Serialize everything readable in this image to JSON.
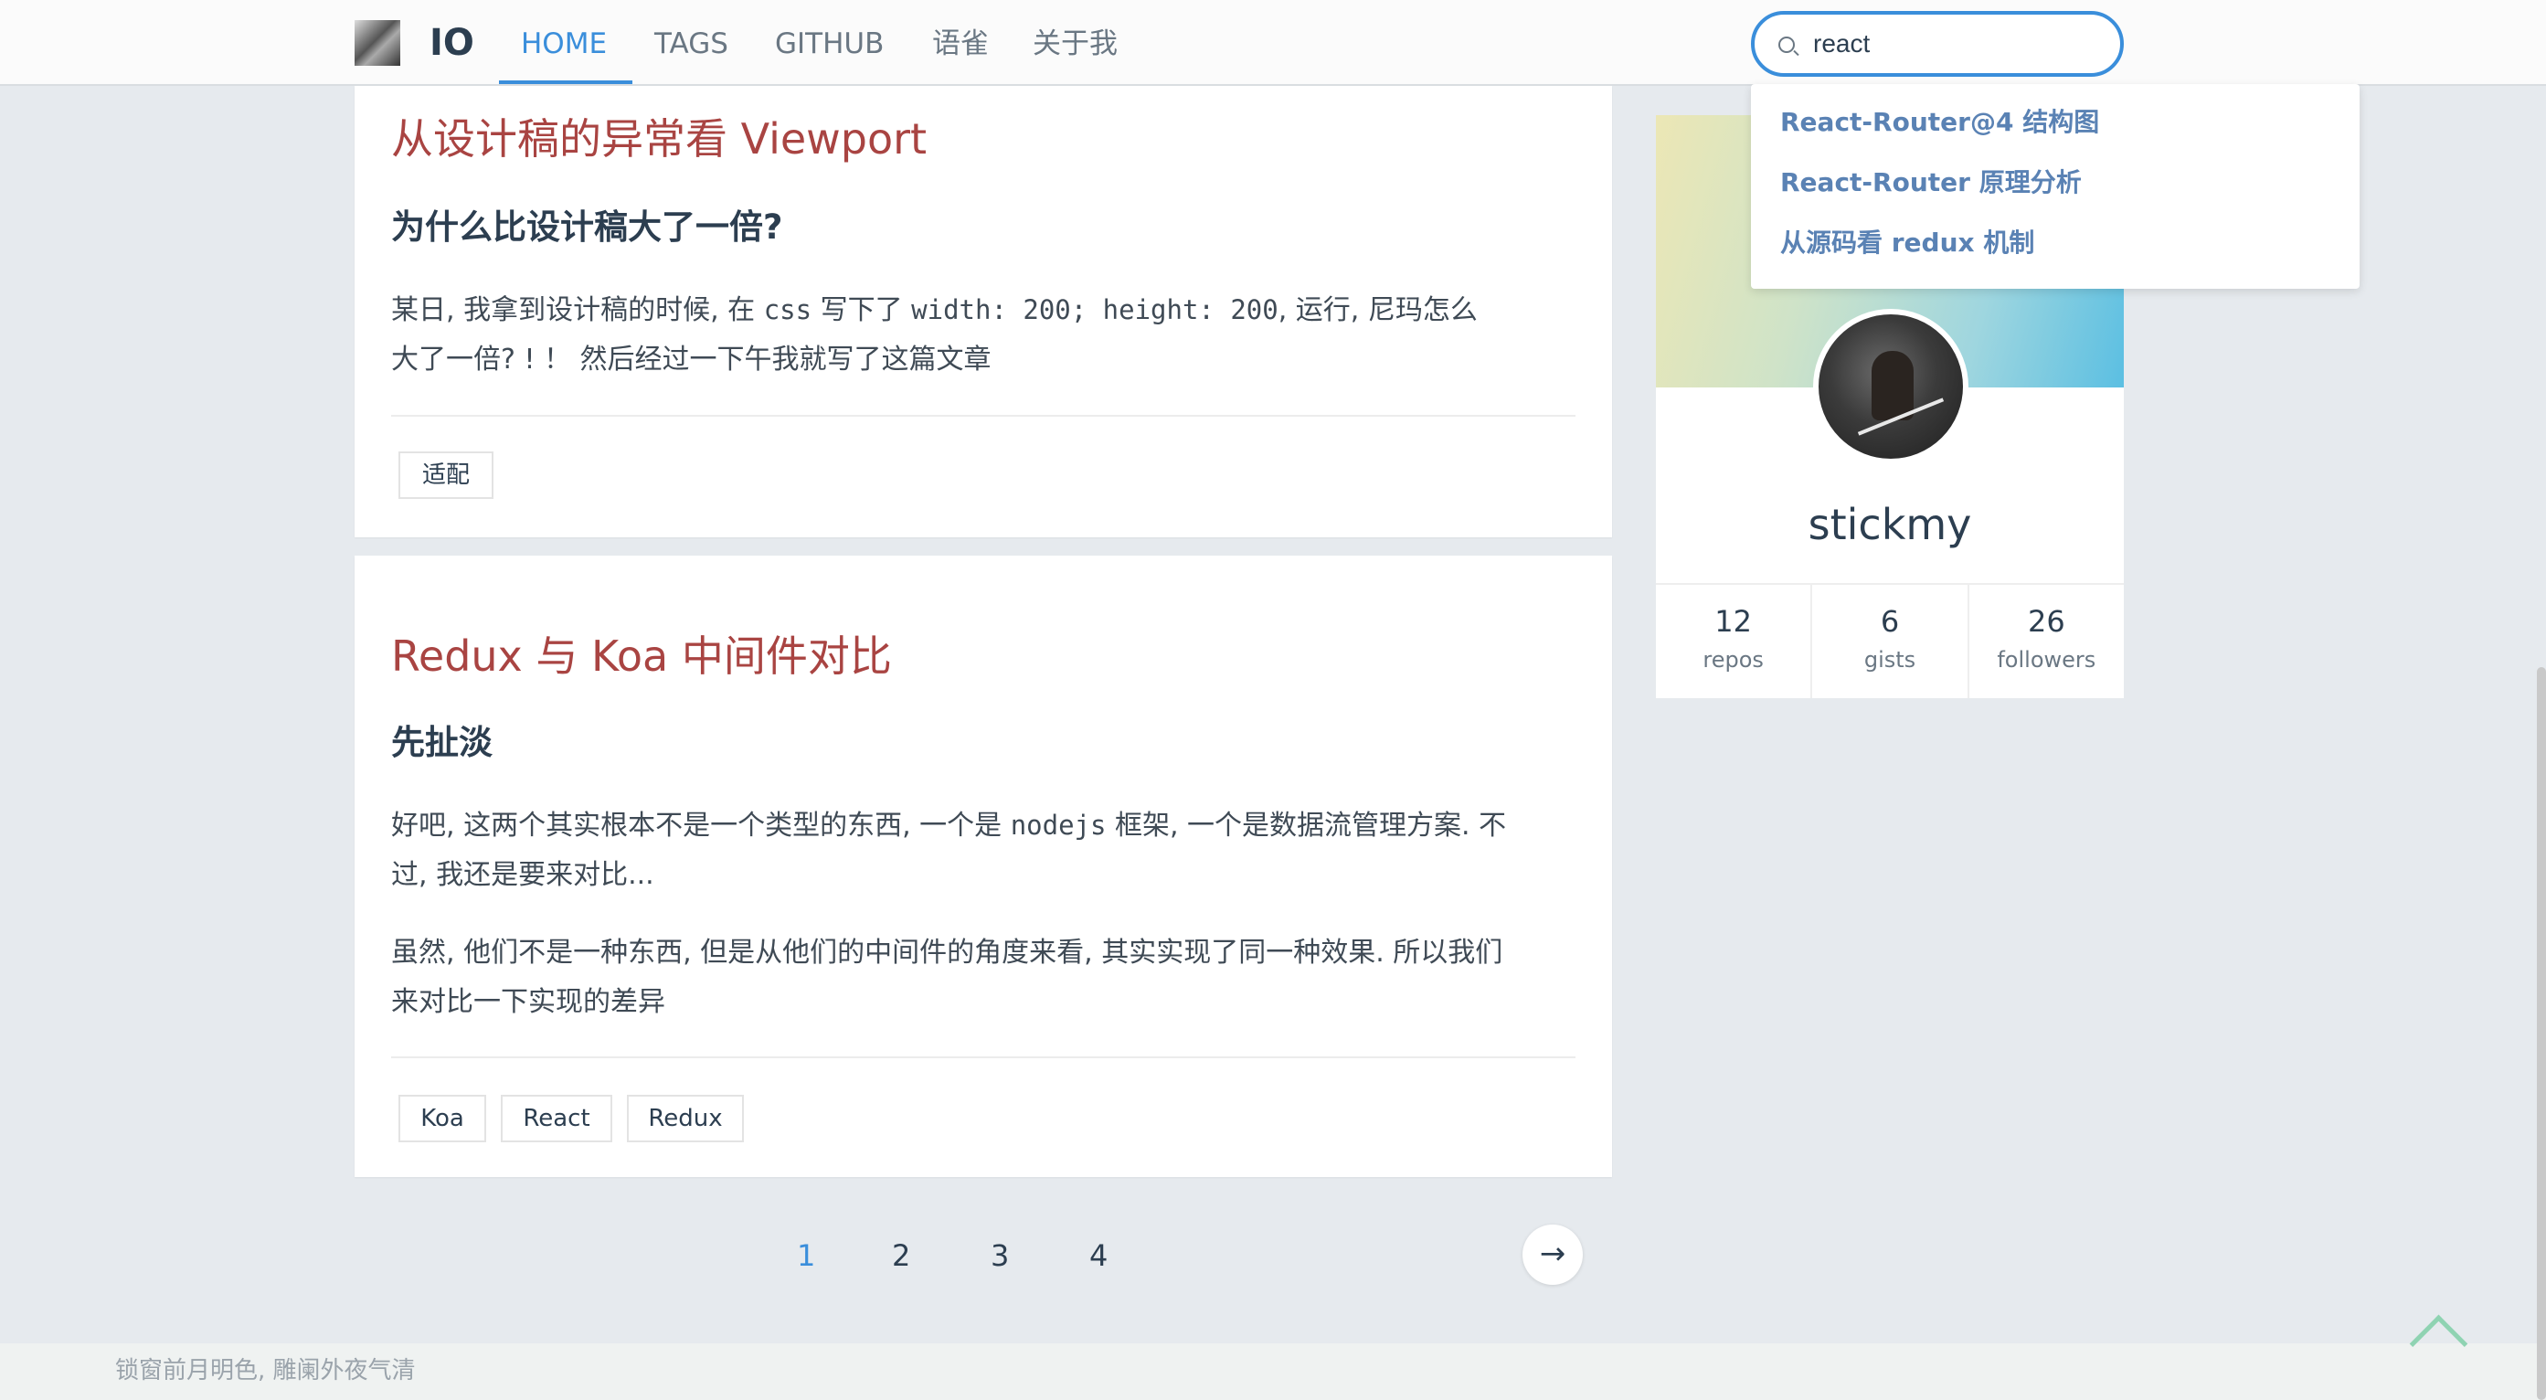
{
  "nav": {
    "logo_text": "IO",
    "items": [
      {
        "label": "HOME",
        "active": true
      },
      {
        "label": "TAGS",
        "active": false
      },
      {
        "label": "GITHUB",
        "active": false
      },
      {
        "label": "语雀",
        "active": false
      },
      {
        "label": "关于我",
        "active": false
      }
    ]
  },
  "search": {
    "value": "react",
    "suggestions": [
      "React-Router@4 结构图",
      "React-Router 原理分析",
      "从源码看 redux 机制"
    ]
  },
  "posts": [
    {
      "title": "从设计稿的异常看 Viewport",
      "subtitle": "为什么比设计稿大了一倍?",
      "p1_a": "某日, 我拿到设计稿的时候, 在 ",
      "p1_code1": "css",
      "p1_b": " 写下了 ",
      "p1_code2": "width: 200; height: 200",
      "p1_c": ", 运行, 尼玛怎么",
      "p1_line2": "大了一倍? ! ！ 然后经过一下午我就写了这篇文章",
      "tags": [
        "适配"
      ]
    },
    {
      "title": "Redux 与 Koa 中间件对比",
      "subtitle": "先扯淡",
      "p1_a": "好吧, 这两个其实根本不是一个类型的东西, 一个是 ",
      "p1_code": "nodejs",
      "p1_b": " 框架, 一个是数据流管理方案. 不",
      "p1_line2": "过, 我还是要来对比...",
      "p2_line1": "虽然, 他们不是一种东西, 但是从他们的中间件的角度来看, 其实实现了同一种效果. 所以我们",
      "p2_line2": "来对比一下实现的差异",
      "tags": [
        "Koa",
        "React",
        "Redux"
      ]
    }
  ],
  "profile": {
    "name": "stickmy",
    "stats": [
      {
        "num": "12",
        "label": "repos"
      },
      {
        "num": "6",
        "label": "gists"
      },
      {
        "num": "26",
        "label": "followers"
      }
    ]
  },
  "pagination": {
    "pages": [
      "1",
      "2",
      "3",
      "4"
    ],
    "current": "1",
    "next_icon": "→"
  },
  "footer": {
    "text": "锁窗前月明色, 雕阑外夜气清"
  },
  "colors": {
    "accent": "#3a8edb",
    "title": "#a94442",
    "background": "#e6eaee"
  }
}
